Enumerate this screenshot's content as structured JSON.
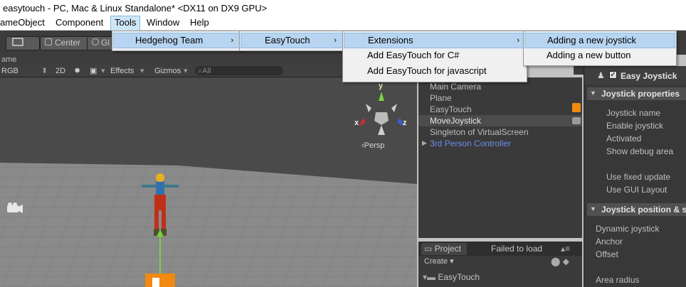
{
  "window": {
    "title": "easytouch - PC, Mac & Linux Standalone* <DX11 on DX9 GPU>"
  },
  "menubar": {
    "items": [
      "ameObject",
      "Component",
      "Tools",
      "Window",
      "Help"
    ]
  },
  "toolbar": {
    "center_label": "Center",
    "global_partial": "Gl"
  },
  "scene": {
    "tab_partial": "ame",
    "shading": "RGB",
    "mode_2d": "2D",
    "effects": "Effects",
    "gizmos": "Gizmos",
    "search_placeholder": "All",
    "axis_x": "x",
    "axis_y": "y",
    "axis_z": "z",
    "persp": "Persp"
  },
  "hierarchy": {
    "items": [
      "Main Camera",
      "Plane",
      "EasyTouch",
      "MoveJoystick",
      "Singleton of VirtualScreen",
      "3rd Person Controller"
    ]
  },
  "project": {
    "tab": "Project",
    "failed": "Failed to load",
    "create": "Create",
    "folder": "EasyTouch"
  },
  "inspector": {
    "component": "Easy Joystick",
    "section1": "Joystick properties",
    "props1": [
      "Joystick name",
      "Enable joystick",
      "Activated",
      "Show debug area"
    ],
    "props2": [
      "Use fixed update",
      "Use GUI Layout"
    ],
    "section2": "Joystick position & size",
    "props3": [
      "Dynamic joystick",
      "Anchor",
      "Offset"
    ],
    "props4": [
      "Area radius"
    ]
  },
  "menus": {
    "tools": [
      "Hedgehog Team"
    ],
    "hedgehog": [
      "EasyTouch"
    ],
    "easytouch": [
      "Extensions",
      "Add EasyTouch for C#",
      "Add EasyTouch for javascript"
    ],
    "extensions": [
      "Adding a new joystick",
      "Adding a new button"
    ]
  },
  "colors": {
    "menu_highlight": "#b7d4f0",
    "prefab_blue": "#6c8ee8",
    "scene_bg": "#4a4a4a"
  }
}
